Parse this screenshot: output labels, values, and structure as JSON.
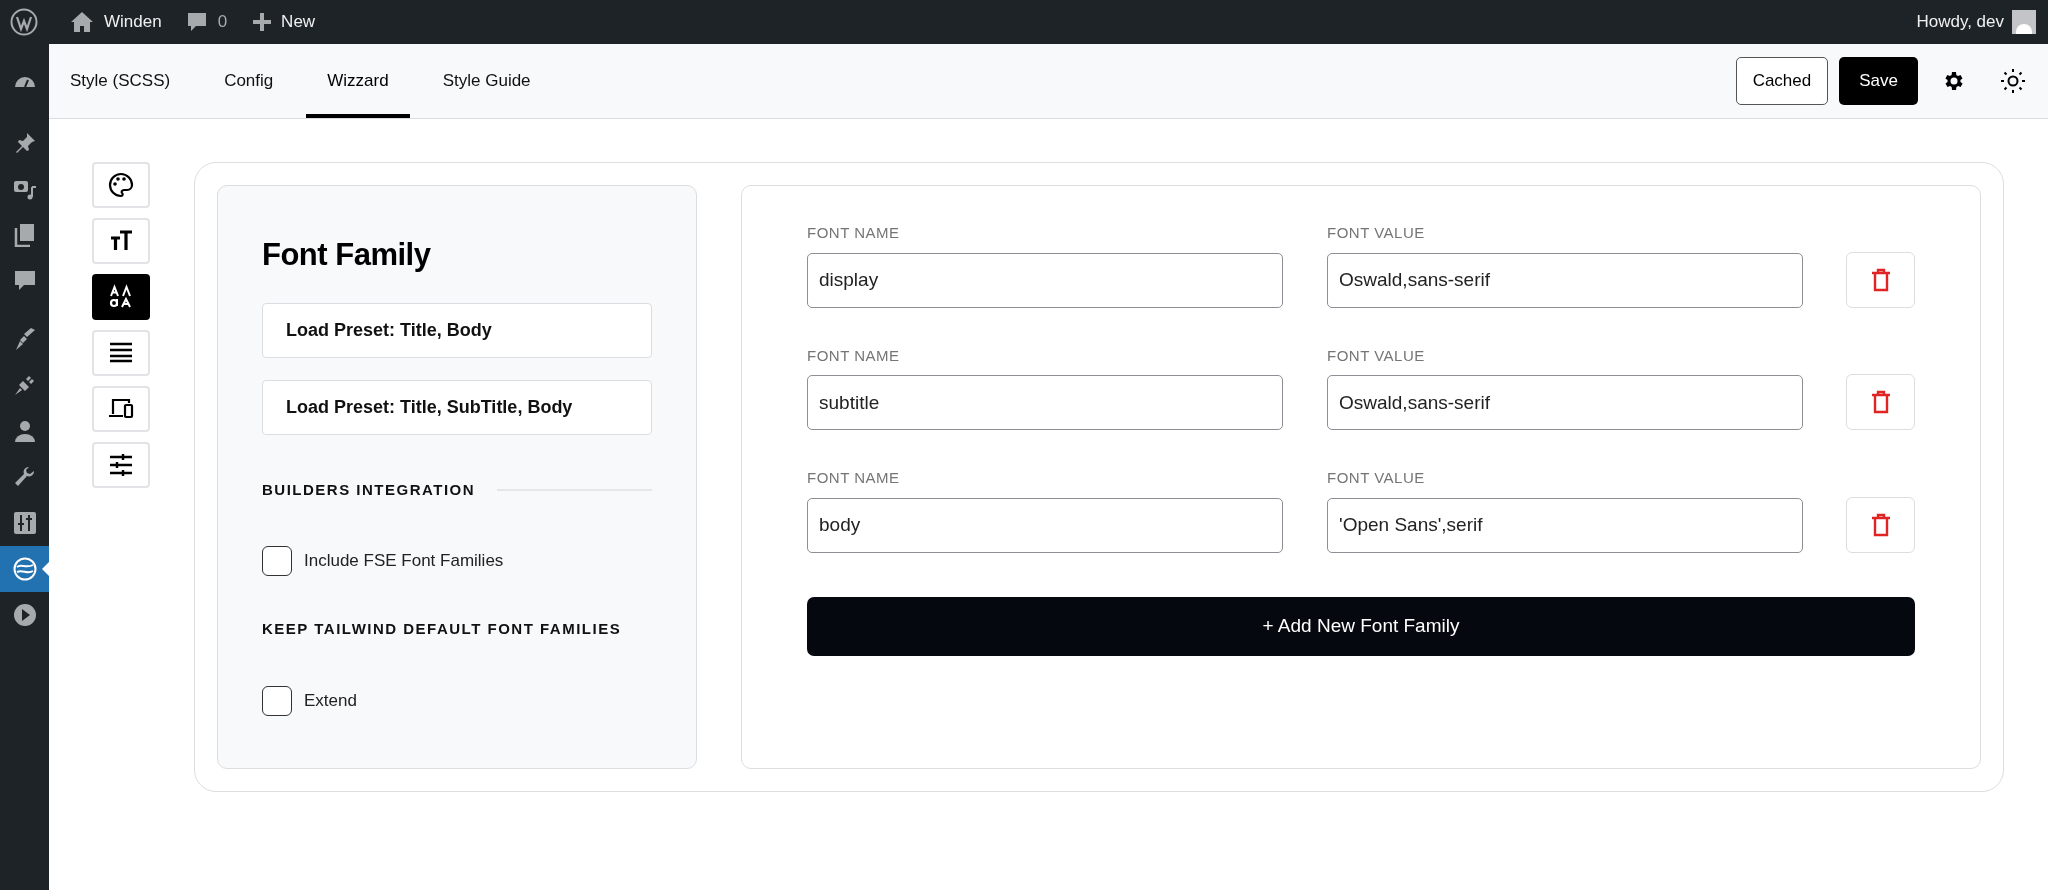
{
  "admin_bar": {
    "site": "Winden",
    "comments": "0",
    "new": "New",
    "greeting": "Howdy, dev"
  },
  "admin_menu": [
    {
      "selected": false
    },
    {
      "selected": false
    },
    {
      "selected": false
    },
    {
      "selected": false
    },
    {
      "selected": false
    },
    {
      "selected": false
    },
    {
      "selected": false
    },
    {
      "selected": false
    },
    {
      "selected": false
    },
    {
      "selected": false
    },
    {
      "selected": true
    },
    {
      "selected": false
    }
  ],
  "tabs": [
    {
      "label": "Style (SCSS)",
      "selected": false
    },
    {
      "label": "Config",
      "selected": false
    },
    {
      "label": "Wizzard",
      "selected": true
    },
    {
      "label": "Style Guide",
      "selected": false
    }
  ],
  "toolbar": {
    "cached": "Cached",
    "save": "Save"
  },
  "wizard_steps": [
    {
      "selected": false
    },
    {
      "selected": false
    },
    {
      "selected": true
    },
    {
      "selected": false
    },
    {
      "selected": false
    },
    {
      "selected": false
    }
  ],
  "panel": {
    "title": "Font Family",
    "presets": [
      "Load Preset: Title, Body",
      "Load Preset: Title, SubTitle, Body"
    ],
    "sections": [
      {
        "heading": "BUILDERS INTEGRATION",
        "divider": true,
        "option": {
          "label": "Include FSE Font Families",
          "checked": false
        }
      },
      {
        "heading": "KEEP TAILWIND DEFAULT FONT FAMILIES",
        "option": {
          "label": "Extend",
          "checked": false
        }
      }
    ]
  },
  "fonts": [
    {
      "name_label": "FONT NAME",
      "name": "display",
      "value_label": "FONT VALUE",
      "value": "Oswald,sans-serif"
    },
    {
      "name_label": "FONT NAME",
      "name": "subtitle",
      "value_label": "FONT VALUE",
      "value": "Oswald,sans-serif"
    },
    {
      "name_label": "FONT NAME",
      "name": "body",
      "value_label": "FONT VALUE",
      "value": "'Open Sans',serif"
    }
  ],
  "add_button": "+ Add New Font Family"
}
